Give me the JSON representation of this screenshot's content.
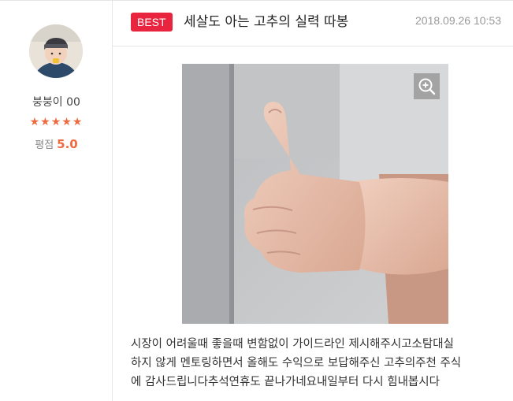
{
  "author": {
    "nickname": "붕붕이 00",
    "stars": "★★★★★",
    "score_label": "평점",
    "score": "5.0"
  },
  "post": {
    "badge": "BEST",
    "title": "세살도 아는 고추의 실력 따봉",
    "date": "2018.09.26 10:53",
    "content_lines": [
      "시장이 어려울때 좋을때 변함없이 가이드라인 제시해주시고소탐대실",
      "하지 않게 멘토링하면서 올해도 수익으로 보답해주신 고추의주천 주식",
      "에 감사드립니다추석연휴도 끝나가네요내일부터 다시 힘내봅시다"
    ]
  },
  "icons": {
    "zoom": "zoom-in-icon"
  },
  "colors": {
    "accent": "#f06a3f",
    "badge": "#e8243f"
  }
}
